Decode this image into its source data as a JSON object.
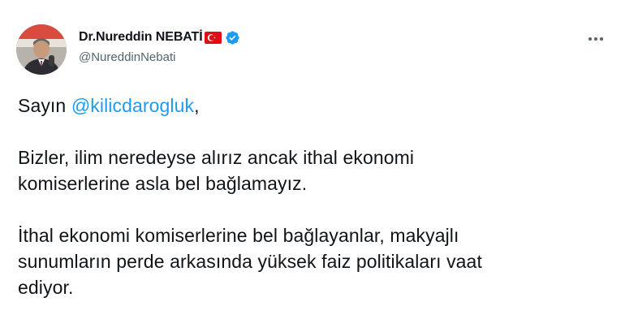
{
  "author": {
    "display_name": "Dr.Nureddin NEBATİ",
    "handle": "@NureddinNebati",
    "flag_icon": "turkey-flag-icon",
    "verified_icon": "verified-badge-icon",
    "verified_color": "#1d9bf0"
  },
  "menu": {
    "icon": "more-options-icon"
  },
  "tweet": {
    "greeting_prefix": "Sayın ",
    "mention": "@kilicdarogluk",
    "greeting_suffix": ",",
    "paragraph_2": "Bizler, ilim neredeyse alırız ancak ithal ekonomi\nkomiserlerine asla bel bağlamayız.",
    "paragraph_3": "İthal ekonomi komiserlerine bel bağlayanlar, makyajlı\nsunumların perde arkasında yüksek faiz politikaları vaat\nediyor."
  },
  "colors": {
    "text": "#0f1419",
    "secondary_text": "#536471",
    "link": "#1d9bf0",
    "flag_red": "#e30a17"
  }
}
